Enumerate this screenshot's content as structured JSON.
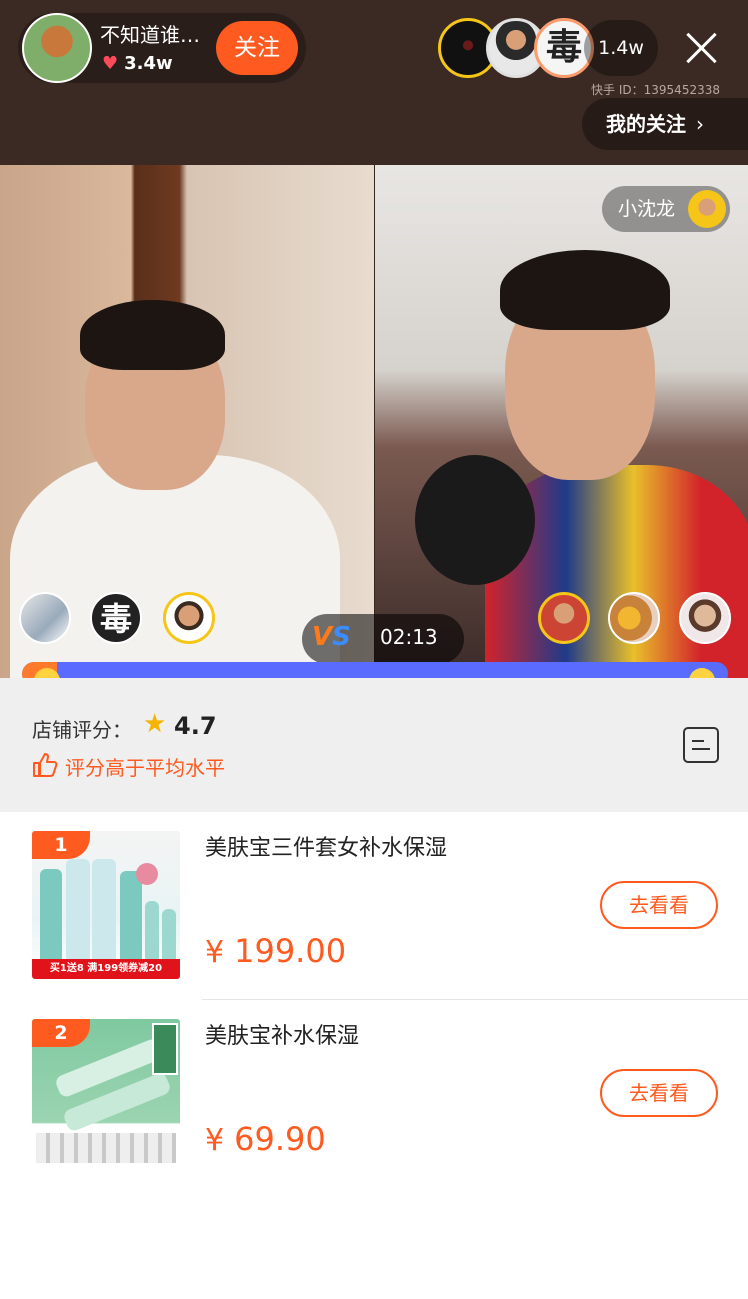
{
  "live": {
    "host_name": "不知道谁…",
    "host_likes": "3.4w",
    "follow_label": "关注",
    "viewer_count": "1.4w",
    "audience_badge_text": "毒",
    "kuaishou_id": "快手 ID：1395452338",
    "my_follow_label": "我的关注",
    "guest_name": "小沈龙",
    "vs_label_a": "V",
    "vs_label_b": "S",
    "timer": "02:13",
    "pk_left_avatar_text": "毒",
    "pk_left_share": 0.05,
    "colors": {
      "accent": "#ff5a1f",
      "pk_blue": "#5a6cff",
      "gold": "#f5c518"
    },
    "icons": [
      "heart-icon",
      "close-icon",
      "chevron-right-icon",
      "vs-icon"
    ]
  },
  "store": {
    "label": "店铺评分：",
    "score": "4.7",
    "note": "评分高于平均水平",
    "icons": [
      "star-icon",
      "thumb-up-icon",
      "list-icon"
    ]
  },
  "products": [
    {
      "rank": "1",
      "title": "美肤宝三件套女补水保湿",
      "currency": "¥",
      "price": "199.00",
      "button": "去看看",
      "promo": "买1送8  满199领券减20"
    },
    {
      "rank": "2",
      "title": "美肤宝补水保湿",
      "currency": "¥",
      "price": "69.90",
      "button": "去看看"
    }
  ]
}
